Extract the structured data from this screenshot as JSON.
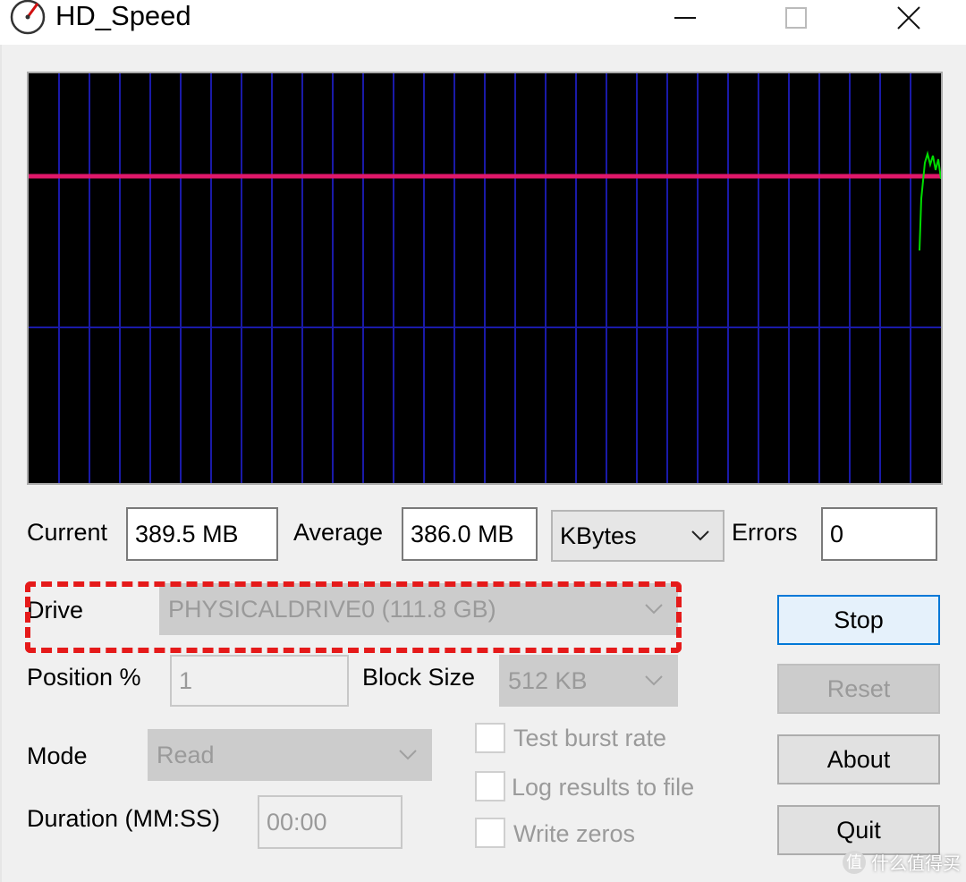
{
  "window": {
    "title": "HD_Speed",
    "icon": "speedometer-icon"
  },
  "graph": {
    "line_color": "#e0186a",
    "trace_color": "#00dd00",
    "grid_color": "#1a1aa8",
    "background": "#000000"
  },
  "stats": {
    "current_label": "Current",
    "current_value": "389.5 MB",
    "average_label": "Average",
    "average_value": "386.0 MB",
    "unit_value": "KBytes",
    "errors_label": "Errors",
    "errors_value": "0"
  },
  "settings": {
    "drive_label": "Drive",
    "drive_value": "PHYSICALDRIVE0 (111.8 GB)",
    "position_label": "Position %",
    "position_value": "1",
    "block_size_label": "Block Size",
    "block_size_value": "512 KB",
    "mode_label": "Mode",
    "mode_value": "Read",
    "duration_label": "Duration (MM:SS)",
    "duration_value": "00:00"
  },
  "options": {
    "test_burst_rate": "Test burst rate",
    "log_results": "Log results to file",
    "write_zeros": "Write zeros"
  },
  "buttons": {
    "stop": "Stop",
    "reset": "Reset",
    "about": "About",
    "quit": "Quit"
  },
  "annotation": {
    "highlight_color": "#e51a1a"
  },
  "watermark": {
    "icon": "值",
    "text": "什么值得买"
  }
}
